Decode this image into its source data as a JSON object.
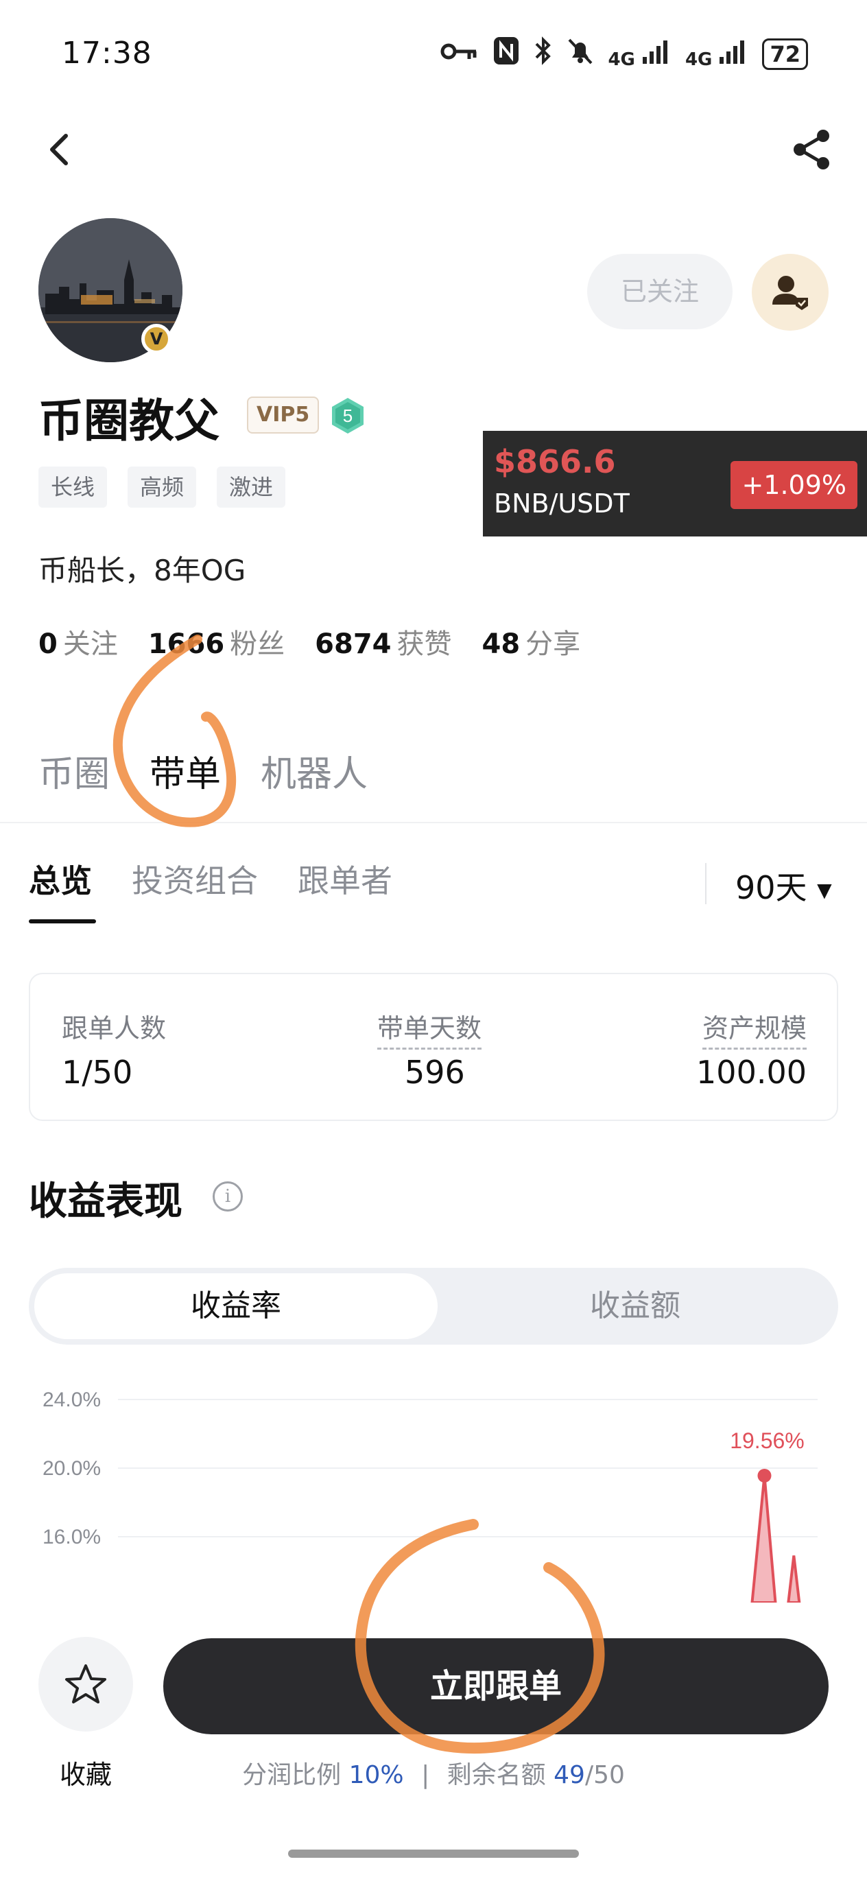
{
  "status_bar": {
    "time": "17:38",
    "signal_1": "4G",
    "signal_2": "4G",
    "battery": "72",
    "icons": [
      "key-icon",
      "nfc-icon",
      "bluetooth-icon",
      "mute-icon",
      "signal-icon",
      "signal-icon",
      "battery-icon"
    ]
  },
  "nav": {
    "back_icon": "back-chevron-icon",
    "share_icon": "share-icon"
  },
  "profile": {
    "name": "币圈教父",
    "vip": "VIP5",
    "level": "5",
    "verified_badge": "V",
    "follow_state": "已关注",
    "tags": [
      "长线",
      "高频",
      "激进"
    ],
    "bio": "币船长，8年OG",
    "stats": [
      {
        "value": "0",
        "label": "关注"
      },
      {
        "value": "1666",
        "label": "粉丝"
      },
      {
        "value": "6874",
        "label": "获赞"
      },
      {
        "value": "48",
        "label": "分享"
      }
    ]
  },
  "ticker": {
    "price": "$866.6",
    "pair": "BNB/USDT",
    "change": "+1.09%"
  },
  "main_tabs": [
    "币圈",
    "带单",
    "机器人"
  ],
  "sub_tabs": [
    "总览",
    "投资组合",
    "跟单者"
  ],
  "period": "90天",
  "summary": {
    "followers_label": "跟单人数",
    "followers_value": "1/50",
    "days_label": "带单天数",
    "days_value": "596",
    "aum_label": "资产规模",
    "aum_value": "100.00"
  },
  "performance": {
    "title": "收益表现",
    "info_icon": "i",
    "segments": [
      "收益率",
      "收益额"
    ]
  },
  "chart_data": {
    "type": "area",
    "yticks": [
      "24.0%",
      "20.0%",
      "16.0%"
    ],
    "ylim": [
      12,
      26
    ],
    "peak_label": "19.56%",
    "peak_value": 19.56,
    "color": "#e0505a",
    "visible_points": [
      {
        "x": 0.924,
        "y": 19.56
      },
      {
        "x": 0.966,
        "y": 14.9
      }
    ]
  },
  "bottom": {
    "fav_label": "收藏",
    "follow_button": "立即跟单",
    "profit_share_label": "分润比例",
    "profit_share_value": "10%",
    "separator": "|",
    "remaining_label": "剩余名额",
    "remaining_value": "49",
    "remaining_total": "/50"
  }
}
